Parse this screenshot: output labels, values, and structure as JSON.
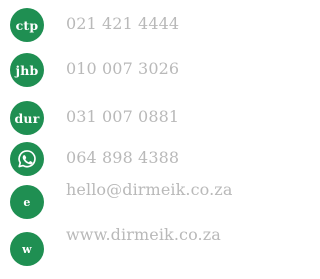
{
  "contacts": [
    {
      "badge": "ctp",
      "text": "021 421 4444"
    },
    {
      "badge": "jhb",
      "text": "010 007 3026"
    },
    {
      "badge": "dur",
      "text": "031 007 0881"
    },
    {
      "badge_icon": "whatsapp-icon",
      "text": "064 898 4388"
    },
    {
      "badge": "e",
      "text": "hello@dirmeik.co.za"
    },
    {
      "badge": "w",
      "text": "www.dirmeik.co.za"
    }
  ],
  "colors": {
    "accent": "#1f8f52",
    "text": "#b9b9b9"
  }
}
